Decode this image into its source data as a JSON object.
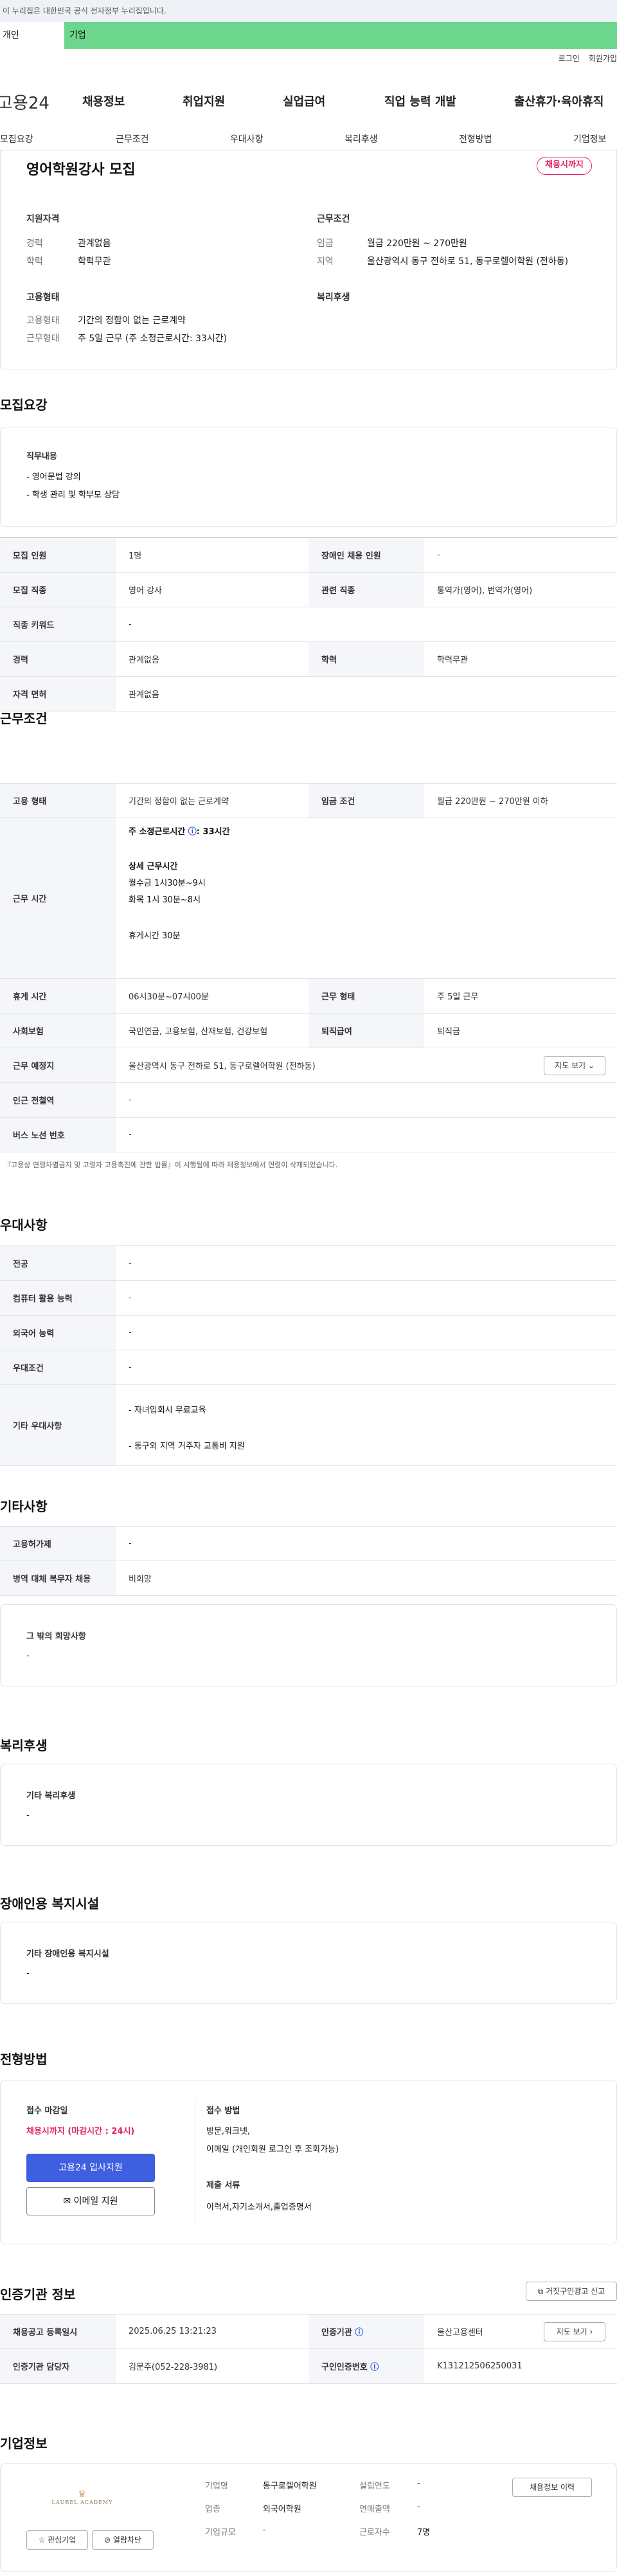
{
  "topbar": {
    "notice": "이 누리집은 대한민국 공식 전자정부 누리집입니다."
  },
  "tabs": {
    "individual": "개인",
    "company": "기업"
  },
  "util": {
    "login": "로그인",
    "signup": "회원가입"
  },
  "gnb": {
    "logo_main": "고용24",
    "items": [
      "채용정보",
      "취업지원",
      "실업급여",
      "직업 능력 개발",
      "출산휴가·육아휴직"
    ]
  },
  "subnav": [
    "모집요강",
    "근무조건",
    "우대사항",
    "복리후생",
    "전형방법",
    "기업정보"
  ],
  "summary": {
    "title": "영어학원강사 모집",
    "badge": "채용시까지",
    "qual_label": "지원자격",
    "cond_label": "근무조건",
    "career_k": "경력",
    "career_v": "관계없음",
    "edu_k": "학력",
    "edu_v": "학력무관",
    "wage_k": "임금",
    "wage_v": "월급 220만원 ~ 270만원",
    "area_k": "지역",
    "area_v": "울산광역시 동구 전하로 51, 동구로렐어학원 (전하동)",
    "emp_label": "고용형태",
    "welfare_label": "복리후생",
    "emptype_k": "고용형태",
    "emptype_v": "기간의 정함이 없는 근로계약",
    "worktype_k": "근무형태",
    "worktype_v": "주 5일 근무 (주 소정근로시간: 33시간)"
  },
  "recruit": {
    "section_title": "모집요강",
    "duty_label": "직무내용",
    "duties": [
      "- 영어문법 강의",
      "- 학생 관리 및 학부모 상담"
    ],
    "rows": [
      [
        "모집 인원",
        "1명",
        "장애인 채용 인원",
        "-"
      ],
      [
        "모집 직종",
        "영어 강사",
        "관련 직종",
        "통역가(영어), 번역가(영어)"
      ],
      [
        "직종 키워드",
        "-",
        "",
        ""
      ],
      [
        "경력",
        "관계없음",
        "학력",
        "학력무관"
      ],
      [
        "자격 면허",
        "관계없음",
        "",
        ""
      ]
    ]
  },
  "conditions": {
    "section_title": "근무조건",
    "emp_th": "고용 형태",
    "emp_td": "기간의 정함이 없는 근로계약",
    "wage_th": "임금 조건",
    "wage_td": "월급 220만원 ~ 270만원 이하",
    "hours_th": "근무 시간",
    "hours_weekly": "주 소정근로시간",
    "hours_weekly_val": ": 33시간",
    "hours_detail_label": "상세 근무시간",
    "hours_lines": [
      "월수금 1시30분~9시",
      "화목 1시 30분~8시"
    ],
    "break_text": "휴게시간 30분",
    "rest_th": "휴게 시간",
    "rest_td": "06시30분~07시00분",
    "form_th": "근무 형태",
    "form_td": "주 5일 근무",
    "ins_th": "사회보험",
    "ins_td": "국민연금, 고용보험, 산재보험, 건강보험",
    "sev_th": "퇴직급여",
    "sev_td": "퇴직금",
    "place_th": "근무 예정지",
    "place_td": "울산광역시 동구 전하로 51, 동구로렐어학원 (전하동)",
    "map_btn": "지도 보기",
    "subway_th": "인근 전철역",
    "subway_td": "-",
    "bus_th": "버스 노선 번호",
    "bus_td": "-",
    "note": "『고용상 연령차별금지 및 고령자 고용촉진에 관한 법률』이 시행됨에 따라 채용정보에서 연령이 삭제되었습니다."
  },
  "preference": {
    "section_title": "우대사항",
    "rows": [
      [
        "전공",
        "-"
      ],
      [
        "컴퓨터 활용 능력",
        "-"
      ],
      [
        "외국어 능력",
        "-"
      ],
      [
        "우대조건",
        "-"
      ]
    ],
    "other_th": "기타 우대사항",
    "other_lines": [
      "- 자녀입회시 무료교육",
      "- 동구외 지역 거주자 교통비 지원"
    ]
  },
  "etc": {
    "section_title": "기타사항",
    "rows": [
      [
        "고용허가제",
        "-"
      ],
      [
        "병역 대체 복무자 채용",
        "비희망"
      ]
    ],
    "wish_label": "그 밖의 희망사항",
    "wish_value": "-"
  },
  "welfare": {
    "section_title": "복리후생",
    "label": "기타 복리후생",
    "value": "-"
  },
  "disability": {
    "section_title": "장애인용 복지시설",
    "label": "기타 장애인용 복지시설",
    "value": "-"
  },
  "selection": {
    "section_title": "전형방법",
    "deadline_label": "접수 마감일",
    "deadline_value": "채용시까지 (마감시간 : 24시)",
    "apply_btn": "고용24 입사지원",
    "email_btn": "이메일 지원",
    "method_label": "접수 방법",
    "methods": [
      "방문,워크넷,",
      "이메일 (개인회원 로그인 후 조회가능)"
    ],
    "docs_label": "제출 서류",
    "docs_value": "이력서,자기소개서,졸업증명서"
  },
  "agency": {
    "section_title": "인증기관 정보",
    "report_btn": "거짓구인광고 신고",
    "reg_th": "채용공고 등록일시",
    "reg_td": "2025.06.25 13:21:23",
    "org_th": "인증기관",
    "org_td": "울산고용센터",
    "map_btn": "지도 보기",
    "mgr_th": "인증기관 담당자",
    "mgr_td": "김문주(052-228-3981)",
    "no_th": "구인인증번호",
    "no_td": "K131212506250031"
  },
  "company": {
    "section_title": "기업정보",
    "logo_text": "LAUREL ACADEMY",
    "fav_btn": "관심기업",
    "block_btn": "열람차단",
    "name_k": "기업명",
    "name_v": "동구로렐어학원",
    "year_k": "설립연도",
    "year_v": "-",
    "ind_k": "업종",
    "ind_v": "외국어학원",
    "sales_k": "연매출액",
    "sales_v": "-",
    "size_k": "기업규모",
    "size_v": "-",
    "emp_k": "근로자수",
    "emp_v": "7명",
    "recruit_btn": "채용정보 이력"
  }
}
